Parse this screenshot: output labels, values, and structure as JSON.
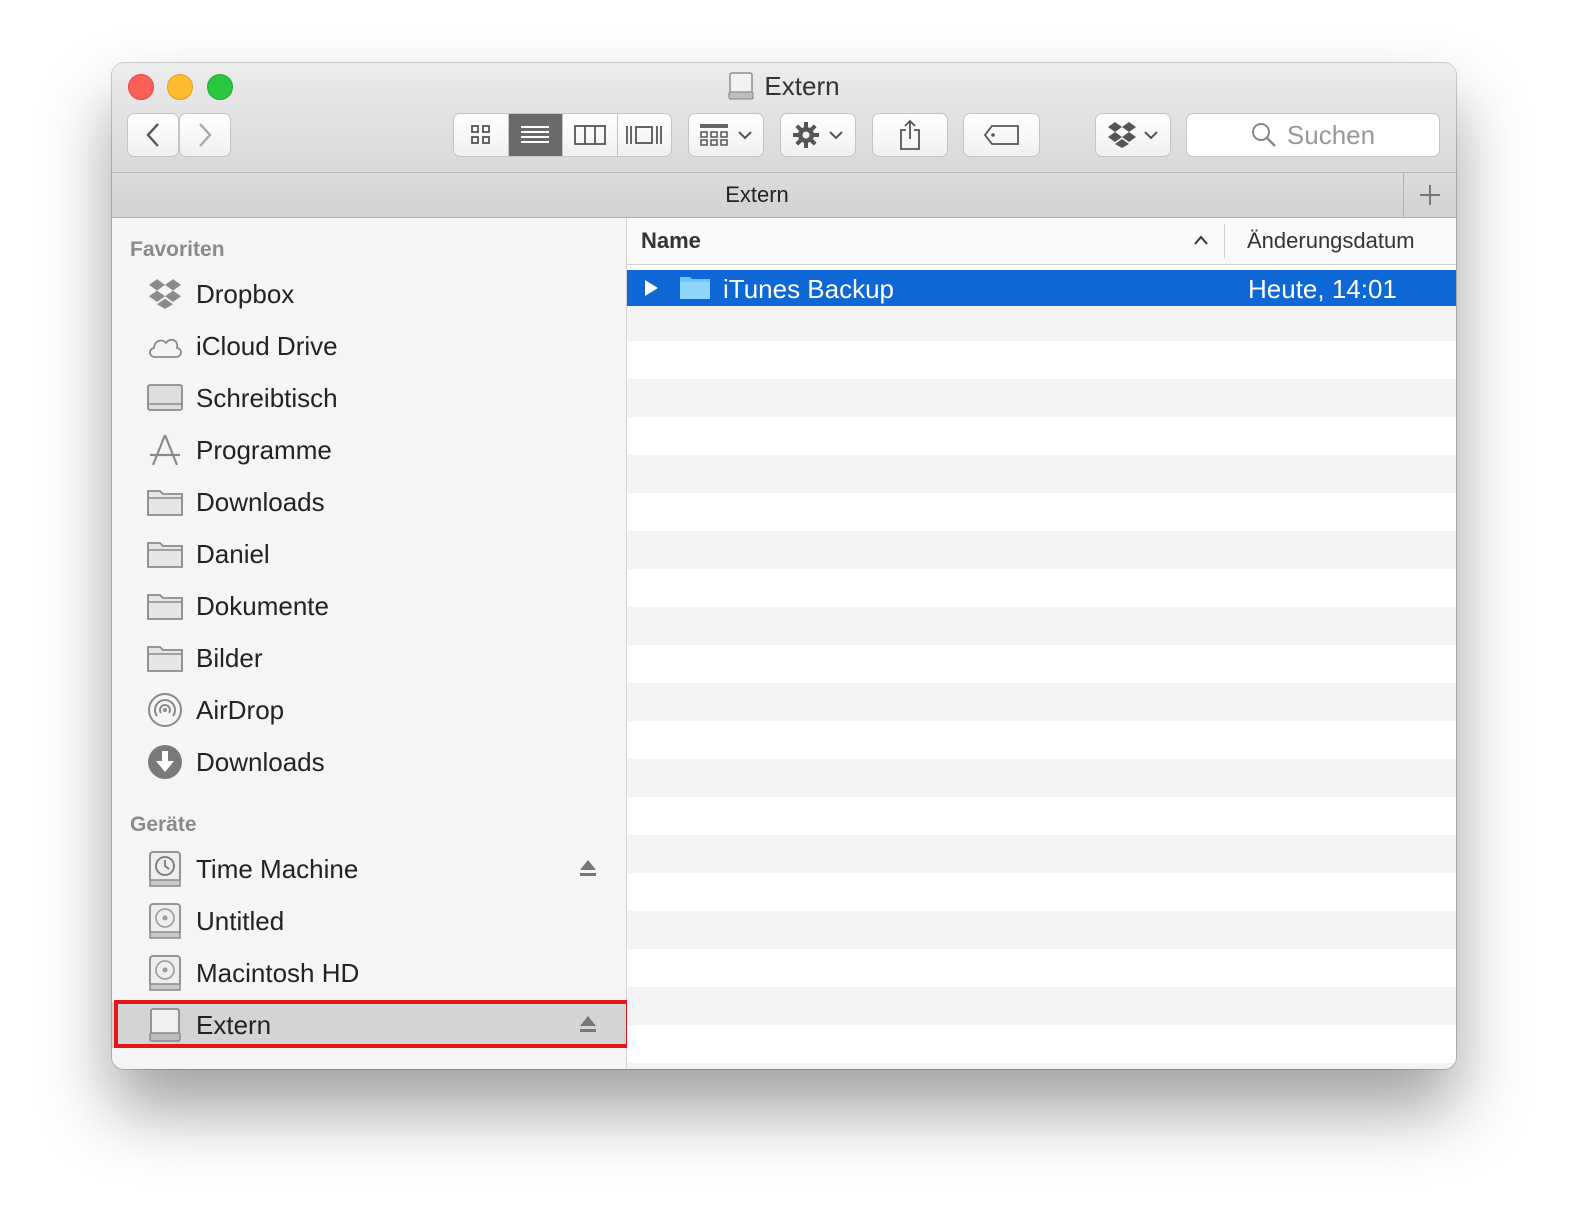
{
  "window": {
    "title": "Extern",
    "title_icon": "external-drive-icon"
  },
  "toolbar": {
    "back_icon": "chevron-left-icon",
    "forward_icon": "chevron-right-icon",
    "view_modes": [
      "icon-view",
      "list-view",
      "column-view",
      "coverflow-view"
    ],
    "active_view": "list-view",
    "arrange_icon": "arrange-icon",
    "action_icon": "gear-icon",
    "share_icon": "share-icon",
    "tag_icon": "tag-icon",
    "dropbox_icon": "dropbox-icon",
    "search_placeholder": "Suchen"
  },
  "pathbar": {
    "title": "Extern",
    "add_icon": "plus-icon"
  },
  "sidebar": {
    "favorites_label": "Favoriten",
    "favorites": [
      {
        "label": "Dropbox",
        "icon": "dropbox-icon"
      },
      {
        "label": "iCloud Drive",
        "icon": "cloud-icon"
      },
      {
        "label": "Schreibtisch",
        "icon": "desktop-icon"
      },
      {
        "label": "Programme",
        "icon": "applications-icon"
      },
      {
        "label": "Downloads",
        "icon": "folder-icon"
      },
      {
        "label": "Daniel",
        "icon": "folder-icon"
      },
      {
        "label": "Dokumente",
        "icon": "folder-icon"
      },
      {
        "label": "Bilder",
        "icon": "folder-icon"
      },
      {
        "label": "AirDrop",
        "icon": "airdrop-icon"
      },
      {
        "label": "Downloads",
        "icon": "download-icon"
      }
    ],
    "devices_label": "Geräte",
    "devices": [
      {
        "label": "Time Machine",
        "icon": "time-machine-icon",
        "ejectable": true
      },
      {
        "label": "Untitled",
        "icon": "hard-drive-icon",
        "ejectable": false
      },
      {
        "label": "Macintosh HD",
        "icon": "hard-drive-icon",
        "ejectable": false
      },
      {
        "label": "Extern",
        "icon": "external-drive-icon",
        "ejectable": true,
        "selected": true
      }
    ]
  },
  "list": {
    "columns": {
      "name": "Name",
      "date": "Änderungsdatum"
    },
    "sort": "name-ascending",
    "rows": [
      {
        "name": "iTunes Backup",
        "date": "Heute, 14:01",
        "type": "folder",
        "selected": true
      }
    ]
  },
  "colors": {
    "selection": "#0d68d6",
    "highlight_box": "#e8141a",
    "close": "#fc5f57",
    "minimize": "#fdbc2e",
    "maximize": "#29c840"
  }
}
